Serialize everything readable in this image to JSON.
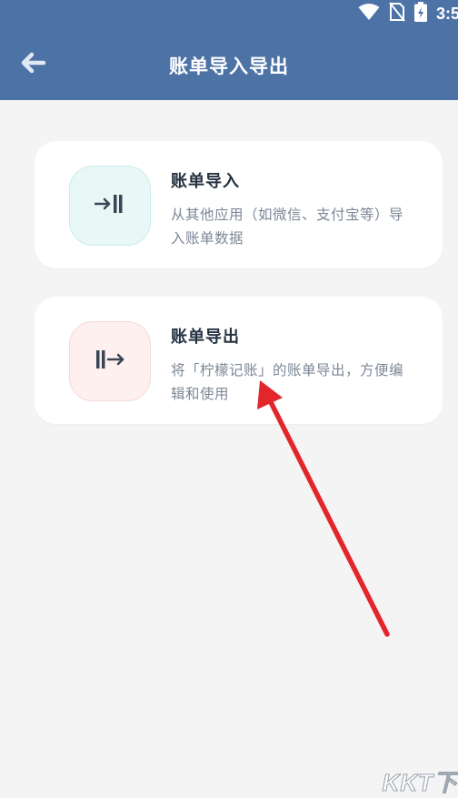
{
  "status_bar": {
    "time": "3:5",
    "icons": [
      "wifi-icon",
      "no-sim-icon",
      "battery-icon"
    ],
    "background": "#4d73a6"
  },
  "app_bar": {
    "title": "账单导入导出",
    "back_icon": "arrow-left-icon",
    "background": "#4d73a6"
  },
  "cards": {
    "import": {
      "title": "账单导入",
      "description": "从其他应用（如微信、支付宝等）导入账单数据",
      "icon": "import-arrow-icon",
      "icon_color": "#3a4656",
      "icon_bg": "#e9f8f7"
    },
    "export": {
      "title": "账单导出",
      "description": "将「柠檬记账」的账单导出，方便编辑和使用",
      "icon": "export-arrow-icon",
      "icon_color": "#3a4656",
      "icon_bg": "#fdf0ef"
    }
  },
  "annotation": {
    "color": "#e3262b"
  },
  "watermark": {
    "text": "KKT下"
  }
}
